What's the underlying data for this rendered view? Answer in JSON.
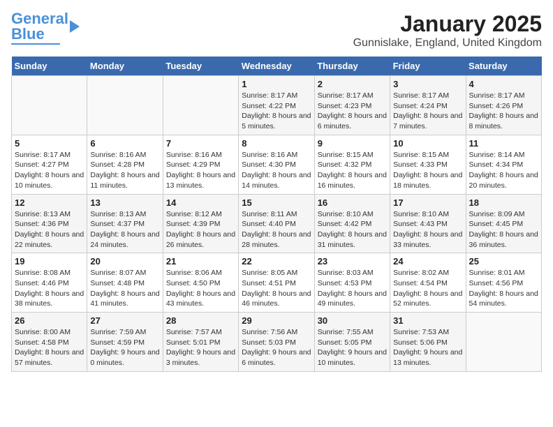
{
  "header": {
    "logo_general": "General",
    "logo_blue": "Blue",
    "title": "January 2025",
    "subtitle": "Gunnislake, England, United Kingdom"
  },
  "weekdays": [
    "Sunday",
    "Monday",
    "Tuesday",
    "Wednesday",
    "Thursday",
    "Friday",
    "Saturday"
  ],
  "weeks": [
    [
      {
        "day": "",
        "info": ""
      },
      {
        "day": "",
        "info": ""
      },
      {
        "day": "",
        "info": ""
      },
      {
        "day": "1",
        "info": "Sunrise: 8:17 AM\nSunset: 4:22 PM\nDaylight: 8 hours and 5 minutes."
      },
      {
        "day": "2",
        "info": "Sunrise: 8:17 AM\nSunset: 4:23 PM\nDaylight: 8 hours and 6 minutes."
      },
      {
        "day": "3",
        "info": "Sunrise: 8:17 AM\nSunset: 4:24 PM\nDaylight: 8 hours and 7 minutes."
      },
      {
        "day": "4",
        "info": "Sunrise: 8:17 AM\nSunset: 4:26 PM\nDaylight: 8 hours and 8 minutes."
      }
    ],
    [
      {
        "day": "5",
        "info": "Sunrise: 8:17 AM\nSunset: 4:27 PM\nDaylight: 8 hours and 10 minutes."
      },
      {
        "day": "6",
        "info": "Sunrise: 8:16 AM\nSunset: 4:28 PM\nDaylight: 8 hours and 11 minutes."
      },
      {
        "day": "7",
        "info": "Sunrise: 8:16 AM\nSunset: 4:29 PM\nDaylight: 8 hours and 13 minutes."
      },
      {
        "day": "8",
        "info": "Sunrise: 8:16 AM\nSunset: 4:30 PM\nDaylight: 8 hours and 14 minutes."
      },
      {
        "day": "9",
        "info": "Sunrise: 8:15 AM\nSunset: 4:32 PM\nDaylight: 8 hours and 16 minutes."
      },
      {
        "day": "10",
        "info": "Sunrise: 8:15 AM\nSunset: 4:33 PM\nDaylight: 8 hours and 18 minutes."
      },
      {
        "day": "11",
        "info": "Sunrise: 8:14 AM\nSunset: 4:34 PM\nDaylight: 8 hours and 20 minutes."
      }
    ],
    [
      {
        "day": "12",
        "info": "Sunrise: 8:13 AM\nSunset: 4:36 PM\nDaylight: 8 hours and 22 minutes."
      },
      {
        "day": "13",
        "info": "Sunrise: 8:13 AM\nSunset: 4:37 PM\nDaylight: 8 hours and 24 minutes."
      },
      {
        "day": "14",
        "info": "Sunrise: 8:12 AM\nSunset: 4:39 PM\nDaylight: 8 hours and 26 minutes."
      },
      {
        "day": "15",
        "info": "Sunrise: 8:11 AM\nSunset: 4:40 PM\nDaylight: 8 hours and 28 minutes."
      },
      {
        "day": "16",
        "info": "Sunrise: 8:10 AM\nSunset: 4:42 PM\nDaylight: 8 hours and 31 minutes."
      },
      {
        "day": "17",
        "info": "Sunrise: 8:10 AM\nSunset: 4:43 PM\nDaylight: 8 hours and 33 minutes."
      },
      {
        "day": "18",
        "info": "Sunrise: 8:09 AM\nSunset: 4:45 PM\nDaylight: 8 hours and 36 minutes."
      }
    ],
    [
      {
        "day": "19",
        "info": "Sunrise: 8:08 AM\nSunset: 4:46 PM\nDaylight: 8 hours and 38 minutes."
      },
      {
        "day": "20",
        "info": "Sunrise: 8:07 AM\nSunset: 4:48 PM\nDaylight: 8 hours and 41 minutes."
      },
      {
        "day": "21",
        "info": "Sunrise: 8:06 AM\nSunset: 4:50 PM\nDaylight: 8 hours and 43 minutes."
      },
      {
        "day": "22",
        "info": "Sunrise: 8:05 AM\nSunset: 4:51 PM\nDaylight: 8 hours and 46 minutes."
      },
      {
        "day": "23",
        "info": "Sunrise: 8:03 AM\nSunset: 4:53 PM\nDaylight: 8 hours and 49 minutes."
      },
      {
        "day": "24",
        "info": "Sunrise: 8:02 AM\nSunset: 4:54 PM\nDaylight: 8 hours and 52 minutes."
      },
      {
        "day": "25",
        "info": "Sunrise: 8:01 AM\nSunset: 4:56 PM\nDaylight: 8 hours and 54 minutes."
      }
    ],
    [
      {
        "day": "26",
        "info": "Sunrise: 8:00 AM\nSunset: 4:58 PM\nDaylight: 8 hours and 57 minutes."
      },
      {
        "day": "27",
        "info": "Sunrise: 7:59 AM\nSunset: 4:59 PM\nDaylight: 9 hours and 0 minutes."
      },
      {
        "day": "28",
        "info": "Sunrise: 7:57 AM\nSunset: 5:01 PM\nDaylight: 9 hours and 3 minutes."
      },
      {
        "day": "29",
        "info": "Sunrise: 7:56 AM\nSunset: 5:03 PM\nDaylight: 9 hours and 6 minutes."
      },
      {
        "day": "30",
        "info": "Sunrise: 7:55 AM\nSunset: 5:05 PM\nDaylight: 9 hours and 10 minutes."
      },
      {
        "day": "31",
        "info": "Sunrise: 7:53 AM\nSunset: 5:06 PM\nDaylight: 9 hours and 13 minutes."
      },
      {
        "day": "",
        "info": ""
      }
    ]
  ]
}
